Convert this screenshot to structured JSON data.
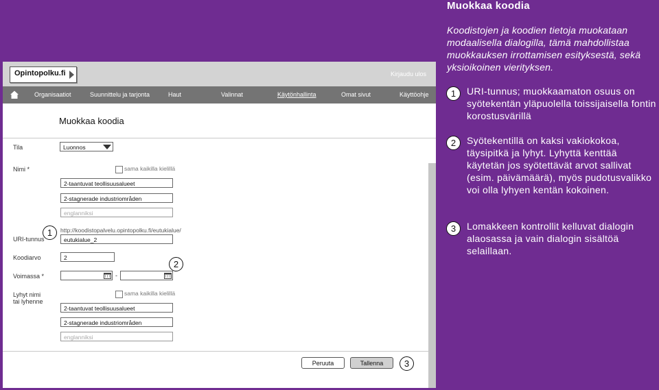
{
  "app": {
    "logo_text": "Opintopolku.fi",
    "logout": "Kirjaudu ulos",
    "nav": [
      "Organisaatiot",
      "Suunnittelu ja tarjonta",
      "Haut",
      "Valinnat",
      "Käytönhallinta",
      "Omat sivut",
      "Käyttöohje"
    ]
  },
  "dialog": {
    "title": "Muokkaa koodia",
    "tila_label": "Tila",
    "tila_value": "Luonnos",
    "nimi_label": "Nimi *",
    "same_all_langs": "sama kaikilla kielillä",
    "nimi_fi": "2-taantuvat teollisuusalueet",
    "nimi_sv": "2-stagnerade industriområden",
    "nimi_en_placeholder": "englanniksi",
    "uri_label": "URI-tunnus",
    "uri_prefix": "http://koodistopalvelu.opintopolku.fi/eutukialue/",
    "uri_value": "eutukialue_2",
    "koodiarvo_label": "Koodiarvo",
    "koodiarvo_value": "2",
    "voimassa_label": "Voimassa *",
    "date_separator": "-",
    "lyhyt_label_1": "Lyhyt nimi",
    "lyhyt_label_2": "tai lyhenne",
    "lyhyt_fi": "2-taantuvat teollisuusalueet",
    "lyhyt_sv": "2-stagnerade industriområden",
    "lyhyt_en_placeholder": "englanniksi",
    "cancel": "Peruuta",
    "save": "Tallenna"
  },
  "badges": [
    "1",
    "2",
    "3"
  ],
  "annotations": {
    "title": "Muokkaa koodia",
    "intro": "Koodistojen ja koodien tietoja muokataan modaalisella dialogilla, tämä mahdollistaa muokkauksen irrottamisen esityksestä, sekä yksioikoinen vierityksen.",
    "notes": [
      "URI-tunnus; muokkaamaton osuus on syötekentän yläpuolella toissijaisella fontin korostusvärillä",
      "Syötekentillä on kaksi vakiokokoa, täysipitkä ja lyhyt. Lyhyttä kenttää käytetän jos syötettävät arvot sallivat (esim. päivämäärä), myös pudotusvalikko voi olla lyhyen kentän kokoinen.",
      "Lomakkeen kontrollit kelluvat dialogin alaosassa ja vain dialogin sisältöä selaillaan."
    ]
  },
  "colors": {
    "background": "#6f2c91",
    "nav": "#747474",
    "topbar": "#d3d3d3"
  }
}
